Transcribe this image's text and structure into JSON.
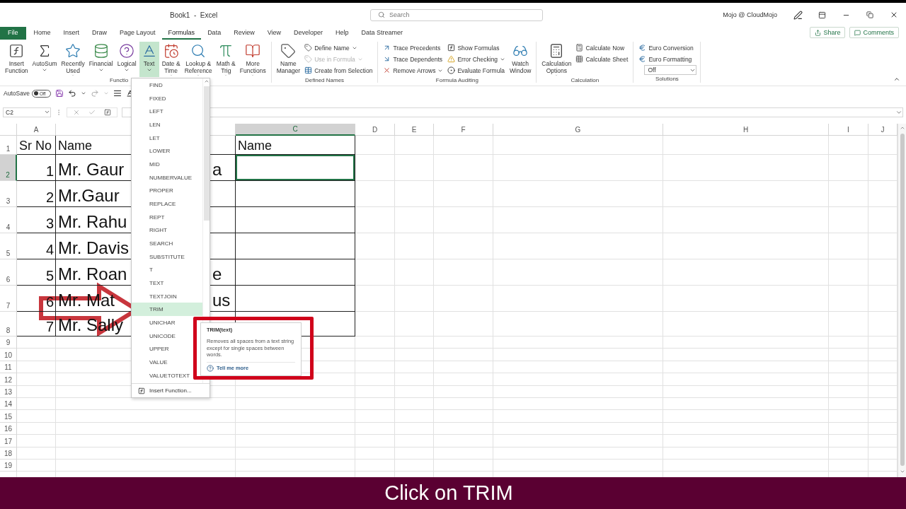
{
  "title_bar": {
    "title": "Book1  -  Excel",
    "search_placeholder": "Search",
    "user": "Mojo @ CloudMojo"
  },
  "tabs": [
    {
      "label": "File",
      "kind": "file",
      "selected": false
    },
    {
      "label": "Home",
      "kind": "tab",
      "selected": false
    },
    {
      "label": "Insert",
      "kind": "tab",
      "selected": false
    },
    {
      "label": "Draw",
      "kind": "tab",
      "selected": false
    },
    {
      "label": "Page Layout",
      "kind": "tab",
      "selected": false
    },
    {
      "label": "Formulas",
      "kind": "tab",
      "selected": true
    },
    {
      "label": "Data",
      "kind": "tab",
      "selected": false
    },
    {
      "label": "Review",
      "kind": "tab",
      "selected": false
    },
    {
      "label": "View",
      "kind": "tab",
      "selected": false
    },
    {
      "label": "Developer",
      "kind": "tab",
      "selected": false
    },
    {
      "label": "Help",
      "kind": "tab",
      "selected": false
    },
    {
      "label": "Data Streamer",
      "kind": "tab",
      "selected": false
    }
  ],
  "share": "Share",
  "comments": "Comments",
  "ribbon": {
    "groups": [
      {
        "label": "Functio",
        "items": [
          {
            "kind": "large",
            "label": "Insert\nFunction",
            "has_menu": false,
            "selected": false
          },
          {
            "kind": "large",
            "label": "AutoSum",
            "has_menu": true,
            "selected": false
          },
          {
            "kind": "large",
            "label": "Recently\nUsed",
            "has_menu": true,
            "selected": false
          },
          {
            "kind": "large",
            "label": "Financial",
            "has_menu": true,
            "selected": false
          },
          {
            "kind": "large",
            "label": "Logical",
            "has_menu": true,
            "selected": false
          },
          {
            "kind": "large",
            "label": "Text",
            "has_menu": true,
            "selected": true
          },
          {
            "kind": "large",
            "label": "Date &\nTime",
            "has_menu": true,
            "selected": false
          },
          {
            "kind": "large",
            "label": "Lookup &\nReference",
            "has_menu": true,
            "selected": false
          },
          {
            "kind": "large",
            "label": "Math &\nTrig",
            "has_menu": true,
            "selected": false
          },
          {
            "kind": "large",
            "label": "More\nFunctions",
            "has_menu": true,
            "selected": false
          }
        ]
      },
      {
        "label": "Defined Names",
        "items": [
          {
            "kind": "large",
            "label": "Name\nManager",
            "has_menu": false,
            "selected": false
          },
          {
            "kind": "stack",
            "items": [
              {
                "kind": "button",
                "label": "Define Name",
                "has_menu": true,
                "disabled": false
              },
              {
                "kind": "button",
                "label": "Use in Formula",
                "has_menu": true,
                "disabled": true
              },
              {
                "kind": "button",
                "label": "Create from Selection",
                "has_menu": false,
                "disabled": false
              }
            ]
          }
        ]
      },
      {
        "label": "Formula Auditing",
        "items": [
          {
            "kind": "stack",
            "items": [
              {
                "kind": "button",
                "label": "Trace Precedents",
                "has_menu": false,
                "disabled": false
              },
              {
                "kind": "button",
                "label": "Trace Dependents",
                "has_menu": false,
                "disabled": false
              },
              {
                "kind": "button",
                "label": "Remove Arrows",
                "has_menu": true,
                "disabled": false
              }
            ]
          },
          {
            "kind": "stack",
            "items": [
              {
                "kind": "button",
                "label": "Show Formulas",
                "has_menu": false,
                "disabled": false
              },
              {
                "kind": "button",
                "label": "Error Checking",
                "has_menu": true,
                "disabled": false
              },
              {
                "kind": "button",
                "label": "Evaluate Formula",
                "has_menu": false,
                "disabled": false
              }
            ]
          },
          {
            "kind": "large",
            "label": "Watch\nWindow",
            "has_menu": false,
            "selected": false
          }
        ]
      },
      {
        "label": "Calculation",
        "items": [
          {
            "kind": "large",
            "label": "Calculation\nOptions",
            "has_menu": true,
            "selected": false
          },
          {
            "kind": "stack",
            "items": [
              {
                "kind": "button",
                "label": "Calculate Now",
                "has_menu": false,
                "disabled": false
              },
              {
                "kind": "button",
                "label": "Calculate Sheet",
                "has_menu": false,
                "disabled": false
              }
            ]
          }
        ]
      },
      {
        "label": "Solutions",
        "items": [
          {
            "kind": "stack",
            "items": [
              {
                "kind": "button",
                "label": "Euro Conversion",
                "has_menu": false,
                "disabled": false
              },
              {
                "kind": "button",
                "label": "Euro Formatting",
                "has_menu": false,
                "disabled": false
              },
              {
                "kind": "select",
                "value": "Off"
              }
            ]
          }
        ]
      }
    ]
  },
  "quick_access": {
    "autosave_label": "AutoSave",
    "autosave": {
      "on": false,
      "label": "Off"
    }
  },
  "formula_bar": {
    "name_box": "C2"
  },
  "sheet": {
    "columns": [
      {
        "label": "A",
        "selected": false
      },
      {
        "selected": false
      },
      {
        "label": "C",
        "selected": true
      },
      {
        "label": "D",
        "selected": false
      },
      {
        "label": "E",
        "selected": false
      },
      {
        "label": "F",
        "selected": false
      },
      {
        "label": "G",
        "selected": false
      },
      {
        "label": "H",
        "selected": false
      },
      {
        "label": "I",
        "selected": false
      },
      {
        "label": "J",
        "selected": false
      }
    ],
    "rows": [
      {
        "number": "1",
        "selected": false,
        "cells": [
          {
            "text": "Sr No",
            "selected": false
          },
          {
            "text": "Name",
            "selected": false
          },
          {
            "text": "Name",
            "selected": false
          }
        ]
      },
      {
        "number": "2",
        "selected": true,
        "cells": [
          {
            "text": "1",
            "selected": false
          },
          {
            "text": "Mr. Gaur",
            "text_end": "a",
            "selected": false
          },
          {
            "selected": true
          }
        ]
      },
      {
        "number": "3",
        "selected": false,
        "cells": [
          {
            "text": "2",
            "selected": false
          },
          {
            "text": "Mr.Gaur",
            "selected": false
          },
          {
            "selected": false
          }
        ]
      },
      {
        "number": "4",
        "selected": false,
        "cells": [
          {
            "text": "3",
            "selected": false
          },
          {
            "text": "Mr. Rahu",
            "selected": false
          },
          {
            "selected": false
          }
        ]
      },
      {
        "number": "5",
        "selected": false,
        "cells": [
          {
            "text": "4",
            "selected": false
          },
          {
            "text": "Mr. Davis",
            "selected": false
          },
          {
            "selected": false
          }
        ]
      },
      {
        "number": "6",
        "selected": false,
        "cells": [
          {
            "text": "5",
            "selected": false
          },
          {
            "text": "Mr. Roan",
            "text_end": "e",
            "selected": false
          },
          {
            "selected": false
          }
        ]
      },
      {
        "number": "7",
        "selected": false,
        "cells": [
          {
            "text": "6",
            "selected": false
          },
          {
            "text": "Mr. Mat",
            "text_end": "us",
            "selected": false
          },
          {
            "selected": false
          }
        ]
      },
      {
        "number": "8",
        "selected": false,
        "cells": [
          {
            "text": "7",
            "selected": false
          },
          {
            "text": "Mr. Sally",
            "selected": false
          },
          {
            "selected": false
          }
        ]
      },
      {
        "number": "9",
        "selected": false
      },
      {
        "number": "10",
        "selected": false
      },
      {
        "number": "11",
        "selected": false
      },
      {
        "number": "12",
        "selected": false
      },
      {
        "number": "13",
        "selected": false
      },
      {
        "number": "14",
        "selected": false
      },
      {
        "number": "15",
        "selected": false
      },
      {
        "number": "16",
        "selected": false
      },
      {
        "number": "17",
        "selected": false
      },
      {
        "number": "18",
        "selected": false
      },
      {
        "number": "19",
        "selected": false
      }
    ]
  },
  "dropdown": {
    "items": [
      {
        "label": "FIND",
        "selected": false
      },
      {
        "label": "FIXED",
        "selected": false
      },
      {
        "label": "LEFT",
        "selected": false
      },
      {
        "label": "LEN",
        "selected": false
      },
      {
        "label": "LET",
        "selected": false
      },
      {
        "label": "LOWER",
        "selected": false
      },
      {
        "label": "MID",
        "selected": false
      },
      {
        "label": "NUMBERVALUE",
        "selected": false
      },
      {
        "label": "PROPER",
        "selected": false
      },
      {
        "label": "REPLACE",
        "selected": false
      },
      {
        "label": "REPT",
        "selected": false
      },
      {
        "label": "RIGHT",
        "selected": false
      },
      {
        "label": "SEARCH",
        "selected": false
      },
      {
        "label": "SUBSTITUTE",
        "selected": false
      },
      {
        "label": "T",
        "selected": false
      },
      {
        "label": "TEXT",
        "selected": false
      },
      {
        "label": "TEXTJOIN",
        "selected": false
      },
      {
        "label": "TRIM",
        "selected": true
      },
      {
        "label": "UNICHAR",
        "selected": false
      },
      {
        "label": "UNICODE",
        "selected": false
      },
      {
        "label": "UPPER",
        "selected": false
      },
      {
        "label": "VALUE",
        "selected": false
      },
      {
        "label": "VALUETOTEXT",
        "selected": false
      }
    ],
    "footer": "Insert Function..."
  },
  "tooltip": {
    "title": "TRIM(text)",
    "description": "Removes all spaces from a text string except for single spaces between words.",
    "link": "Tell me more"
  },
  "caption": "Click on TRIM"
}
